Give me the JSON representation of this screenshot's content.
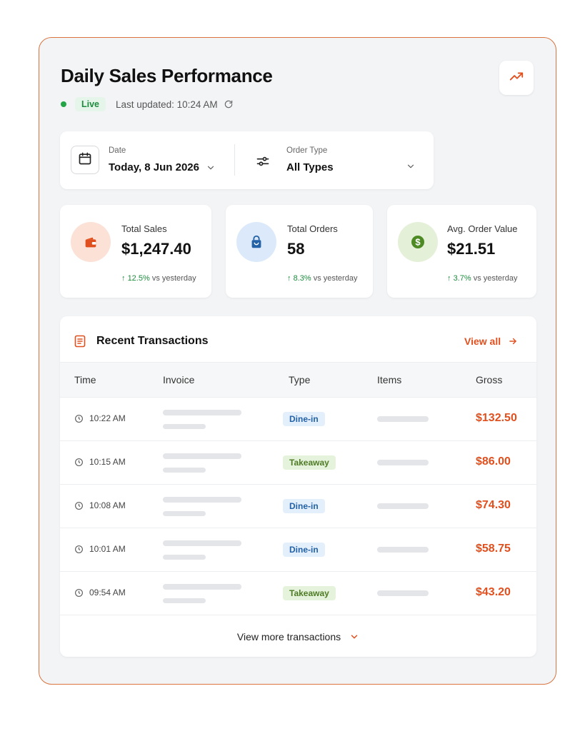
{
  "header": {
    "title": "Daily Sales Performance",
    "live_label": "Live",
    "last_updated": "Last updated: 10:24 AM"
  },
  "filters": {
    "date_label": "Date",
    "date_value": "Today, 8 Jun 2026",
    "order_type_label": "Order Type",
    "order_type_value": "All Types"
  },
  "stats": [
    {
      "label": "Total Sales",
      "value": "$1,247.40",
      "delta": "12.5%",
      "delta_suffix": " vs yesterday"
    },
    {
      "label": "Total Orders",
      "value": "58",
      "delta": "8.3%",
      "delta_suffix": " vs yesterday"
    },
    {
      "label": "Avg. Order Value",
      "value": "$21.51",
      "delta": "3.7%",
      "delta_suffix": " vs yesterday"
    }
  ],
  "transactions": {
    "title": "Recent Transactions",
    "view_all": "View all",
    "columns": [
      "Time",
      "Invoice",
      "Type",
      "Items",
      "Gross"
    ],
    "rows": [
      {
        "time": "10:22 AM",
        "type": "Dine-in",
        "gross": "$132.50"
      },
      {
        "time": "10:15 AM",
        "type": "Takeaway",
        "gross": "$86.00"
      },
      {
        "time": "10:08 AM",
        "type": "Dine-in",
        "gross": "$74.30"
      },
      {
        "time": "10:01 AM",
        "type": "Dine-in",
        "gross": "$58.75"
      },
      {
        "time": "09:54 AM",
        "type": "Takeaway",
        "gross": "$43.20"
      }
    ],
    "view_more": "View more transactions"
  },
  "colors": {
    "accent": "#e0501f",
    "live_green": "#22a447",
    "border": "#d9743f"
  },
  "icons": [
    "trending-up-icon",
    "refresh-icon",
    "calendar-icon",
    "sliders-icon",
    "chevron-down-icon",
    "wallet-icon",
    "shopping-bag-icon",
    "dollar-icon",
    "receipt-icon",
    "arrow-right-icon",
    "clock-icon"
  ]
}
